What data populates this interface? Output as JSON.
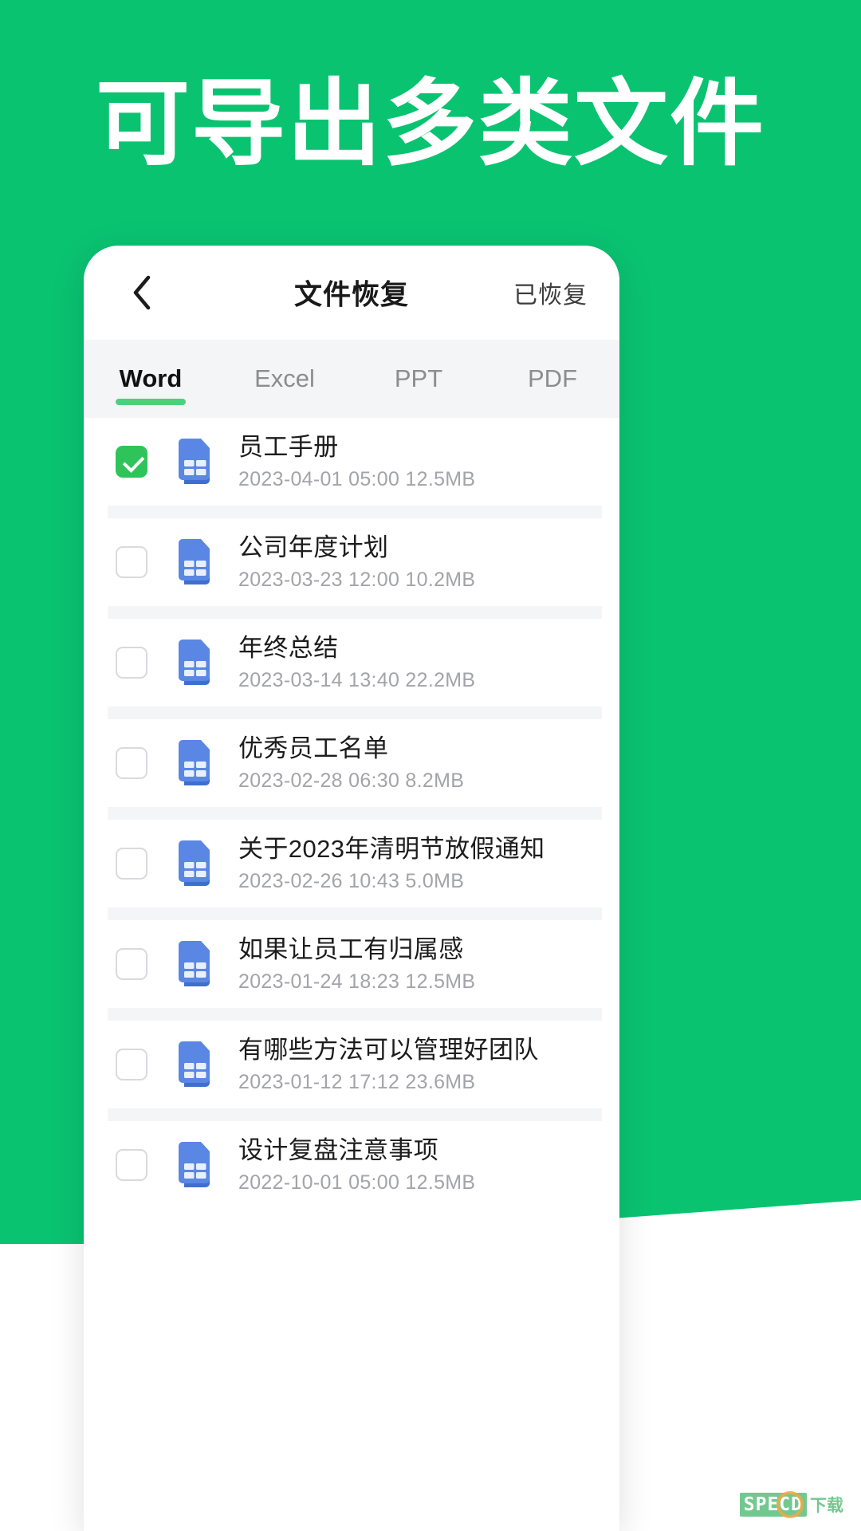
{
  "headline": "可导出多类文件",
  "theme": {
    "brand_green": "#0ac371",
    "accent_green": "#4dd07d",
    "check_green": "#2ec45a",
    "doc_blue": "#4a7ce0",
    "tab_bg": "#f4f5f7"
  },
  "nav": {
    "back_icon": "chevron-left-icon",
    "title": "文件恢复",
    "action_label": "已恢复"
  },
  "tabs": [
    {
      "label": "Word",
      "active": true
    },
    {
      "label": "Excel",
      "active": false
    },
    {
      "label": "PPT",
      "active": false
    },
    {
      "label": "PDF",
      "active": false
    }
  ],
  "files": [
    {
      "name": "员工手册",
      "date": "2023-04-01",
      "time": "05:00",
      "size": "12.5MB",
      "checked": true,
      "icon": "word-doc-icon"
    },
    {
      "name": "公司年度计划",
      "date": "2023-03-23",
      "time": "12:00",
      "size": "10.2MB",
      "checked": false,
      "icon": "word-doc-icon"
    },
    {
      "name": "年终总结",
      "date": "2023-03-14",
      "time": "13:40",
      "size": "22.2MB",
      "checked": false,
      "icon": "word-doc-icon"
    },
    {
      "name": "优秀员工名单",
      "date": "2023-02-28",
      "time": "06:30",
      "size": "8.2MB",
      "checked": false,
      "icon": "word-doc-icon"
    },
    {
      "name": "关于2023年清明节放假通知",
      "date": "2023-02-26",
      "time": "10:43",
      "size": "5.0MB",
      "checked": false,
      "icon": "word-doc-icon"
    },
    {
      "name": "如果让员工有归属感",
      "date": "2023-01-24",
      "time": "18:23",
      "size": "12.5MB",
      "checked": false,
      "icon": "word-doc-icon"
    },
    {
      "name": "有哪些方法可以管理好团队",
      "date": "2023-01-12",
      "time": "17:12",
      "size": "23.6MB",
      "checked": false,
      "icon": "word-doc-icon"
    },
    {
      "name": "设计复盘注意事项",
      "date": "2022-10-01",
      "time": "05:00",
      "size": "12.5MB",
      "checked": false,
      "icon": "word-doc-icon"
    }
  ],
  "watermark": {
    "badge": "SPECD",
    "text": "下载"
  }
}
